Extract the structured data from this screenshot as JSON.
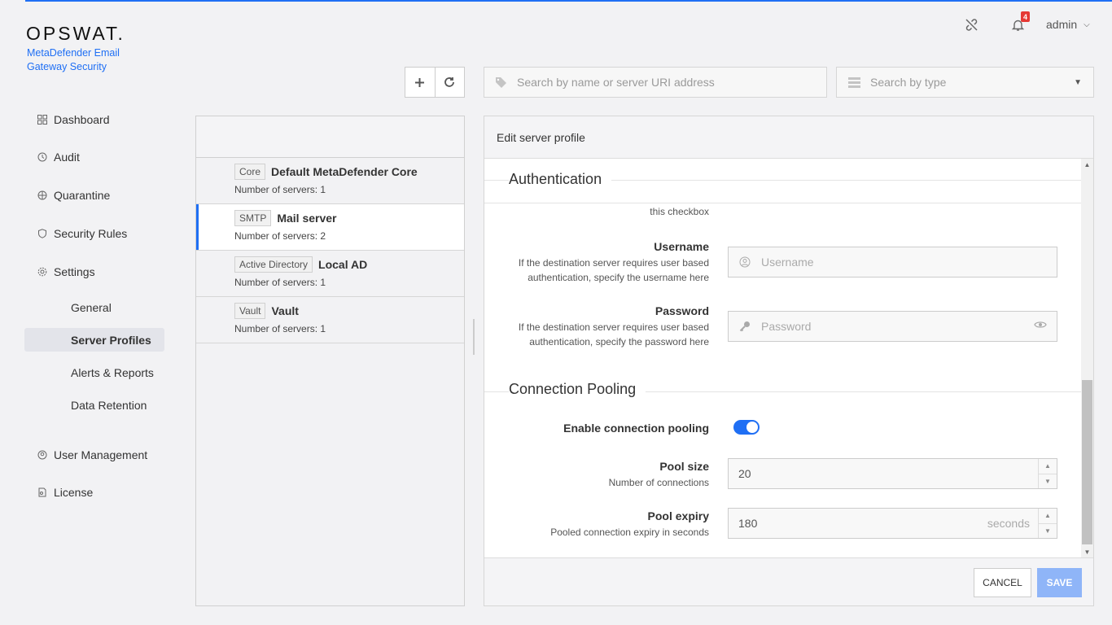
{
  "brand": {
    "logo": "OPSWAT.",
    "product": "MetaDefender Email Gateway Security"
  },
  "header": {
    "user": "admin",
    "notification_count": "4"
  },
  "sidebar": {
    "items": [
      {
        "label": "Dashboard",
        "icon": "dashboard-icon"
      },
      {
        "label": "Audit",
        "icon": "audit-icon"
      },
      {
        "label": "Quarantine",
        "icon": "quarantine-icon"
      },
      {
        "label": "Security Rules",
        "icon": "shield-icon"
      },
      {
        "label": "Settings",
        "icon": "gear-icon"
      },
      {
        "label": "User Management",
        "icon": "users-icon"
      },
      {
        "label": "License",
        "icon": "license-icon"
      }
    ],
    "settings_sub": [
      {
        "label": "General"
      },
      {
        "label": "Server Profiles",
        "active": true
      },
      {
        "label": "Alerts & Reports"
      },
      {
        "label": "Data Retention"
      }
    ]
  },
  "toolbar": {
    "search_name_placeholder": "Search by name or server URI address",
    "search_type_placeholder": "Search by type"
  },
  "profiles": [
    {
      "tag": "Core",
      "name": "Default MetaDefender Core",
      "count": "Number of servers: 1"
    },
    {
      "tag": "SMTP",
      "name": "Mail server",
      "count": "Number of servers: 2",
      "active": true
    },
    {
      "tag": "Active Directory",
      "name": "Local AD",
      "count": "Number of servers: 1"
    },
    {
      "tag": "Vault",
      "name": "Vault",
      "count": "Number of servers: 1"
    }
  ],
  "edit": {
    "title": "Edit server profile",
    "auth_section": "Authentication",
    "checkbox_hint_tail": "this checkbox",
    "username_label": "Username",
    "username_desc": "If the destination server requires user based authentication, specify the username here",
    "username_placeholder": "Username",
    "password_label": "Password",
    "password_desc": "If the destination server requires user based authentication, specify the password here",
    "password_placeholder": "Password",
    "pool_section": "Connection Pooling",
    "pool_enable_label": "Enable connection pooling",
    "pool_enabled": true,
    "pool_size_label": "Pool size",
    "pool_size_desc": "Number of connections",
    "pool_size_value": "20",
    "pool_expiry_label": "Pool expiry",
    "pool_expiry_desc": "Pooled connection expiry in seconds",
    "pool_expiry_value": "180",
    "pool_expiry_unit": "seconds",
    "cancel_label": "CANCEL",
    "save_label": "SAVE"
  },
  "colors": {
    "accent": "#1f6ff4",
    "badge": "#e53935",
    "save_disabled": "#8fb5f8"
  }
}
